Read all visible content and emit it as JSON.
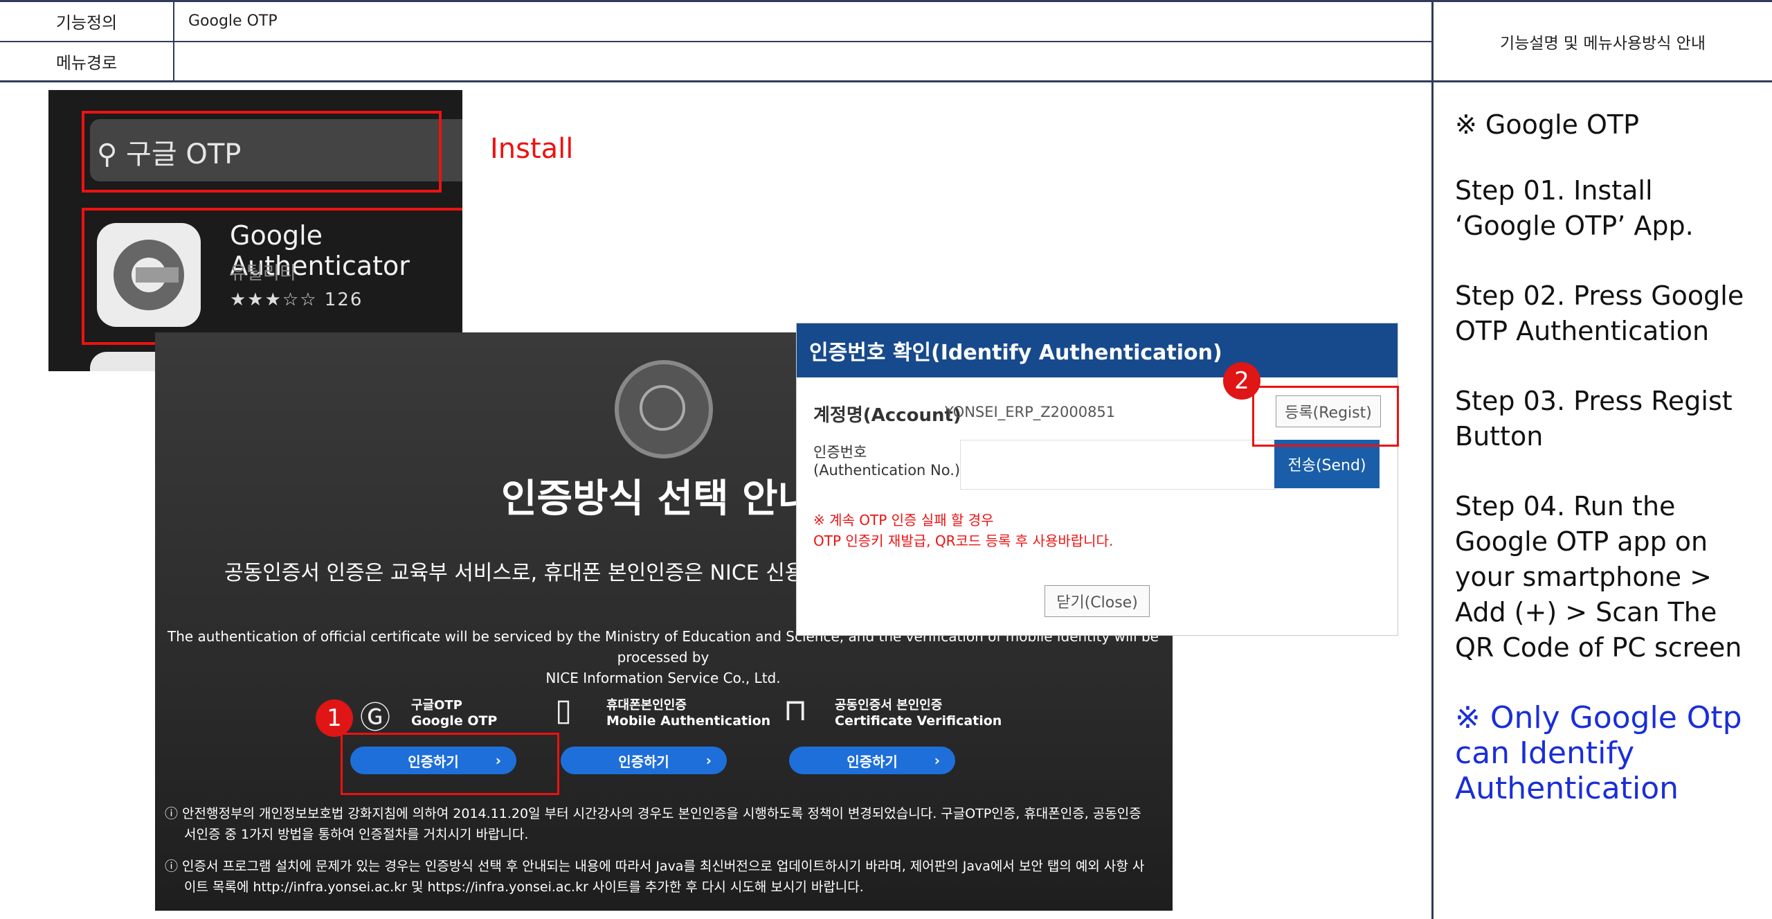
{
  "header": {
    "func_def_label": "기능정의",
    "func_def_value": "Google OTP",
    "menu_path_label": "메뉴경로",
    "menu_path_value": "",
    "side_header": "기능설명 및 메뉴사용방식 안내"
  },
  "sidebar": {
    "title": "※ Google OTP",
    "steps": [
      "Step 01.  Install ‘Google OTP’ App.",
      "Step 02. Press Google OTP Authentication",
      "Step 03.  Press Regist Button",
      "Step 04. Run the Google OTP app on your smartphone > Add (+) > Scan The QR Code of PC screen"
    ],
    "note": "※ Only Google Otp can Identify Authentication"
  },
  "appstore": {
    "search_text": "구글 OTP",
    "app_name": "Google Authenticator",
    "app_category": "유틸리티",
    "app_rating": "★★★☆☆ 126"
  },
  "install_label": "Install",
  "auth_page": {
    "title": "인증방식 선택 안내",
    "subtitle": "공동인증서 인증은 교육부 서비스로, 휴대폰 본인인증은 NICE 신용",
    "english_line1": "The authentication of official certificate will be serviced by the Ministry of Education and Science, and the verification of mobile identity will be processed by",
    "english_line2": "NICE Information Service Co., Ltd.",
    "options": [
      {
        "ko": "구글OTP",
        "en": "Google OTP",
        "button": "인증하기",
        "icon": "google-icon"
      },
      {
        "ko": "휴대폰본인인증",
        "en": "Mobile Authentication",
        "button": "인증하기",
        "icon": "phone-icon"
      },
      {
        "ko": "공동인증서 본인인증",
        "en": "Certificate Verification",
        "button": "인증하기",
        "icon": "lock-icon"
      }
    ],
    "chevron": "›",
    "notice1_line1": "ⓘ 안전행정부의 개인정보보호법 강화지침에 의하여 2014.11.20일 부터 시간강사의 경우도 본인인증을 시행하도록 정책이 변경되었습니다. 구글OTP인증, 휴대폰인증, 공동인증",
    "notice1_line2": "서인증 중 1가지 방법을 통하여 인증절차를 거치시기 바랍니다.",
    "notice2_line1": "ⓘ 인증서 프로그램 설치에 문제가 있는 경우는 인증방식 선택 후 안내되는 내용에 따라서 Java를 최신버전으로 업데이트하시기 바라며, 제어판의 Java에서 보안 탭의 예외 사항 사",
    "notice2_line2": "이트 목록에 http://infra.yonsei.ac.kr 및 https://infra.yonsei.ac.kr 사이트를 추가한 후 다시 시도해 보시기 바랍니다."
  },
  "modal": {
    "title": "인증번호 확인(Identify Authentication)",
    "account_label": "계정명(Account)",
    "account_value": "YONSEI_ERP_Z2000851",
    "regist_button": "등록(Regist)",
    "auth_no_label_ko": "인증번호",
    "auth_no_label_en": "(Authentication No.)",
    "send_button": "전송(Send)",
    "warn1": "※ 계속 OTP 인증 실패 할 경우",
    "warn2": "OTP 인증키 재발급, QR코드 등록 후 사용바랍니다.",
    "close_button": "닫기(Close)"
  },
  "badges": {
    "one": "1",
    "two": "2"
  },
  "colors": {
    "border": "#2f3b59",
    "red": "#e11111",
    "blue_note": "#1a2ed8",
    "modal_head": "#174a8c",
    "auth_button": "#1e6fd9"
  }
}
